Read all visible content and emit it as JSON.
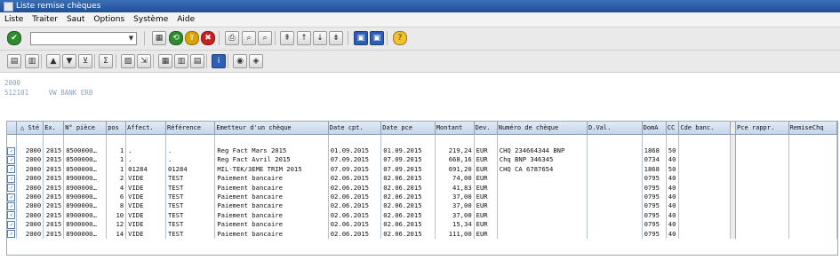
{
  "window": {
    "title": "Liste remise chèques"
  },
  "menu": [
    "Liste",
    "Traiter",
    "Saut",
    "Options",
    "Système",
    "Aide"
  ],
  "toolbar": {
    "command_field": {
      "value": "",
      "placeholder": ""
    },
    "row1_icons": [
      {
        "name": "enter-icon",
        "glyph": "✔",
        "style": "green"
      },
      {
        "name": "save-icon",
        "glyph": "▦",
        "style": ""
      },
      {
        "name": "back-icon",
        "glyph": "⟲",
        "style": "green"
      },
      {
        "name": "exit-icon",
        "glyph": "⇧",
        "style": "yellow"
      },
      {
        "name": "cancel-icon",
        "glyph": "✖",
        "style": "red"
      },
      {
        "name": "print-icon",
        "glyph": "⎙",
        "style": ""
      },
      {
        "name": "find-icon",
        "glyph": "⌕",
        "style": ""
      },
      {
        "name": "find-next-icon",
        "glyph": "⌕",
        "style": ""
      },
      {
        "name": "first-page-icon",
        "glyph": "⇞",
        "style": ""
      },
      {
        "name": "previous-page-icon",
        "glyph": "↑",
        "style": ""
      },
      {
        "name": "next-page-icon",
        "glyph": "↓",
        "style": ""
      },
      {
        "name": "last-page-icon",
        "glyph": "⇟",
        "style": ""
      },
      {
        "name": "new-session-icon",
        "glyph": "▣",
        "style": "blue"
      },
      {
        "name": "shortcut-icon",
        "glyph": "▣",
        "style": "blue"
      },
      {
        "name": "help-icon",
        "glyph": "?",
        "style": "gold"
      }
    ],
    "row2_icons": [
      {
        "name": "details-icon",
        "glyph": "▤",
        "style": ""
      },
      {
        "name": "choose-icon",
        "glyph": "▥",
        "style": ""
      },
      {
        "name": "sort-ascending-icon",
        "glyph": "▲",
        "style": ""
      },
      {
        "name": "sort-descending-icon",
        "glyph": "▼",
        "style": ""
      },
      {
        "name": "filter-icon",
        "glyph": "⊻",
        "style": ""
      },
      {
        "name": "total-icon",
        "glyph": "Σ",
        "style": ""
      },
      {
        "name": "print-preview-icon",
        "glyph": "▧",
        "style": ""
      },
      {
        "name": "export-icon",
        "glyph": "⇲",
        "style": ""
      },
      {
        "name": "view-icon",
        "glyph": "▦",
        "style": ""
      },
      {
        "name": "change-layout-icon",
        "glyph": "▥",
        "style": ""
      },
      {
        "name": "select-layout-icon",
        "glyph": "▤",
        "style": ""
      },
      {
        "name": "information-icon",
        "glyph": "i",
        "style": "blue"
      },
      {
        "name": "graphic-icon",
        "glyph": "◉",
        "style": ""
      },
      {
        "name": "abc-analysis-icon",
        "glyph": "◈",
        "style": ""
      }
    ]
  },
  "header_info": {
    "line1": "2000",
    "line2": "512101     VW BANK ERB"
  },
  "table": {
    "sort_indicator": "△",
    "columns": [
      "Sté",
      "Ex.",
      "N° pièce",
      "pos",
      "Affect.",
      "Référence",
      "Emetteur d'un chèque",
      "Date cpt.",
      "Date pce",
      "Montant",
      "Dev.",
      "Numéro de chèque",
      "D.Val.",
      "DomA",
      "CC",
      "Cde banc.",
      "Pce rappr.",
      "RemiseChq"
    ],
    "rows": [
      [
        "2000",
        "2015",
        "8500000…",
        "1",
        ".",
        ".",
        "Reg Fact Mars 2015",
        "01.09.2015",
        "01.09.2015",
        "219,24",
        "EUR",
        "CHQ 234664344 BNP",
        "",
        "1868",
        "50",
        "",
        "",
        ""
      ],
      [
        "2000",
        "2015",
        "8500000…",
        "1",
        ".",
        ".",
        "Reg Fact Avril 2015",
        "07.09.2015",
        "07.09.2015",
        "668,16",
        "EUR",
        "Chq BNP 346345",
        "",
        "0734",
        "40",
        "",
        "",
        ""
      ],
      [
        "2000",
        "2015",
        "8500000…",
        "1",
        "01284",
        "01284",
        "MIL-TEK/3EME TRIM 2015",
        "07.09.2015",
        "07.09.2015",
        "691,20",
        "EUR",
        "CHQ CA 6787654",
        "",
        "1868",
        "50",
        "",
        "",
        ""
      ],
      [
        "2000",
        "2015",
        "8900000…",
        "2",
        "VIDE",
        "TEST",
        "Paiement bancaire",
        "02.06.2015",
        "02.06.2015",
        "74,00",
        "EUR",
        "",
        "",
        "0795",
        "40",
        "",
        "",
        ""
      ],
      [
        "2000",
        "2015",
        "8900000…",
        "4",
        "VIDE",
        "TEST",
        "Paiement bancaire",
        "02.06.2015",
        "02.06.2015",
        "41,83",
        "EUR",
        "",
        "",
        "0795",
        "40",
        "",
        "",
        ""
      ],
      [
        "2000",
        "2015",
        "8900000…",
        "6",
        "VIDE",
        "TEST",
        "Paiement bancaire",
        "02.06.2015",
        "02.06.2015",
        "37,00",
        "EUR",
        "",
        "",
        "0795",
        "40",
        "",
        "",
        ""
      ],
      [
        "2000",
        "2015",
        "8900000…",
        "8",
        "VIDE",
        "TEST",
        "Paiement bancaire",
        "02.06.2015",
        "02.06.2015",
        "37,00",
        "EUR",
        "",
        "",
        "0795",
        "40",
        "",
        "",
        ""
      ],
      [
        "2000",
        "2015",
        "8900000…",
        "10",
        "VIDE",
        "TEST",
        "Paiement bancaire",
        "02.06.2015",
        "02.06.2015",
        "37,00",
        "EUR",
        "",
        "",
        "0795",
        "40",
        "",
        "",
        ""
      ],
      [
        "2000",
        "2015",
        "8900000…",
        "12",
        "VIDE",
        "TEST",
        "Paiement bancaire",
        "02.06.2015",
        "02.06.2015",
        "15,34",
        "EUR",
        "",
        "",
        "0795",
        "40",
        "",
        "",
        ""
      ],
      [
        "2000",
        "2015",
        "8900000…",
        "14",
        "VIDE",
        "TEST",
        "Paiement bancaire",
        "02.06.2015",
        "02.06.2015",
        "111,00",
        "EUR",
        "",
        "",
        "0795",
        "40",
        "",
        "",
        ""
      ]
    ]
  }
}
